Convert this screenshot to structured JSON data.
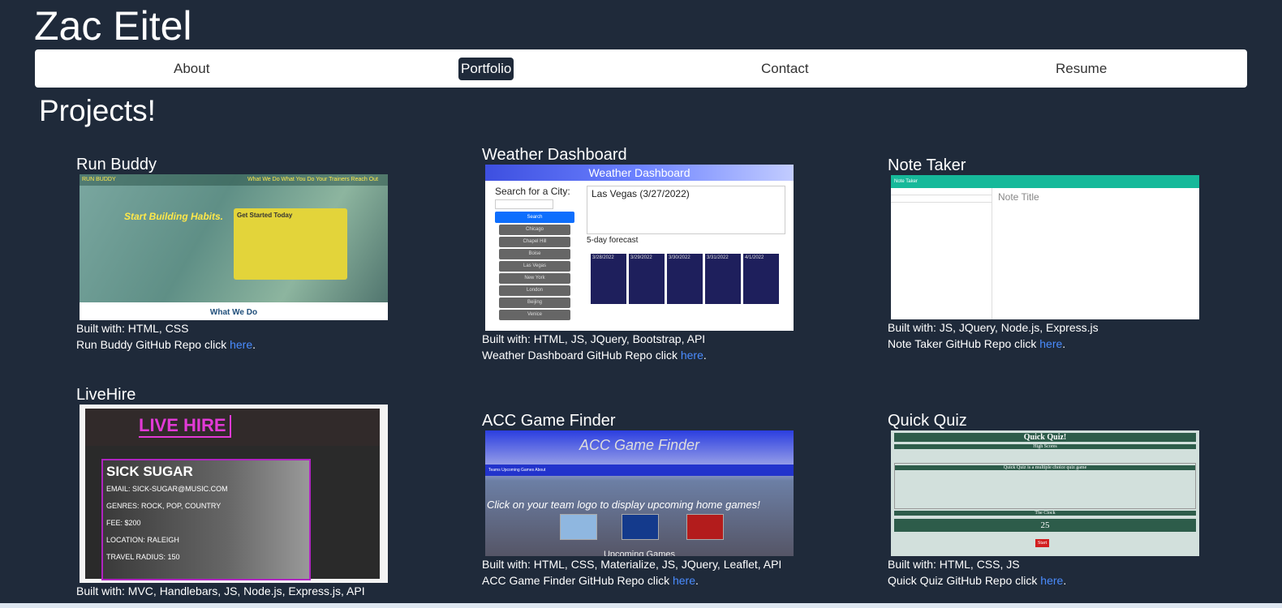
{
  "header": {
    "name": "Zac Eitel"
  },
  "nav": {
    "about": "About",
    "portfolio": "Portfolio",
    "contact": "Contact",
    "resume": "Resume"
  },
  "section_title": "Projects!",
  "built_prefix": "Built with:",
  "link_text": "here",
  "projects": [
    {
      "title": "Run Buddy",
      "built": "Built with: HTML, CSS",
      "repo": "Run Buddy GitHub Repo click",
      "thumb": {
        "logo": "RUN BUDDY",
        "links": "What We Do   What You Do   Your Trainers   Reach Out",
        "headline": "Start Building Habits.",
        "form": "Get Started Today",
        "footer": "What We Do"
      }
    },
    {
      "title": "Weather Dashboard",
      "built": "Built with: HTML, JS, JQuery, Bootstrap, API",
      "repo": "Weather Dashboard GitHub Repo click",
      "thumb": {
        "bar": "Weather Dashboard",
        "search_label": "Search for a City:",
        "search_btn": "Search",
        "cities": [
          "Chicago",
          "Chapel Hill",
          "Boise",
          "Las Vegas",
          "New York",
          "London",
          "Beijing",
          "Venice"
        ],
        "city": "Las Vegas (3/27/2022)",
        "forecast": "5-day forecast",
        "days": [
          "3/28/2022",
          "3/29/2022",
          "3/30/2022",
          "3/31/2022",
          "4/1/2022"
        ]
      }
    },
    {
      "title": "Note Taker",
      "built": "Built with: JS, JQuery, Node.js, Express.js",
      "repo": "Note Taker GitHub Repo click",
      "thumb": {
        "bar": "Note Taker",
        "note_title": "Note Title"
      }
    },
    {
      "title": "LiveHire",
      "built": "Built with: MVC, Handlebars, JS, Node.js, Express.js, API",
      "thumb": {
        "logo": "LIVE HIRE",
        "band": "SICK SUGAR",
        "email": "EMAIL: SICK-SUGAR@MUSIC.COM",
        "genres": "GENRES: ROCK, POP, COUNTRY",
        "fee": "FEE: $200",
        "location": "LOCATION: RALEIGH",
        "travel": "TRAVEL RADIUS: 150"
      }
    },
    {
      "title": "ACC Game Finder",
      "built": "Built with: HTML, CSS, Materialize, JS, JQuery, Leaflet, API",
      "repo": "ACC Game Finder GitHub Repo click",
      "thumb": {
        "header": "ACC Game Finder",
        "nav": "Teams    Upcoming Games    About",
        "message": "Click on your team logo to display upcoming home games!",
        "footer": "Upcoming Games"
      }
    },
    {
      "title": "Quick Quiz",
      "built": "Built with: HTML, CSS, JS",
      "repo": "Quick Quiz GitHub Repo click",
      "thumb": {
        "title": "Quick Quiz!",
        "scores": "High Scores",
        "intro": "Quick Quiz is a multiple choice quiz game",
        "clock": "The Clock",
        "time": "25",
        "start": "Start"
      }
    }
  ],
  "colors": {
    "background": "#1f2a3a",
    "link": "#4a8cff",
    "nav_bg": "#ffffff"
  }
}
